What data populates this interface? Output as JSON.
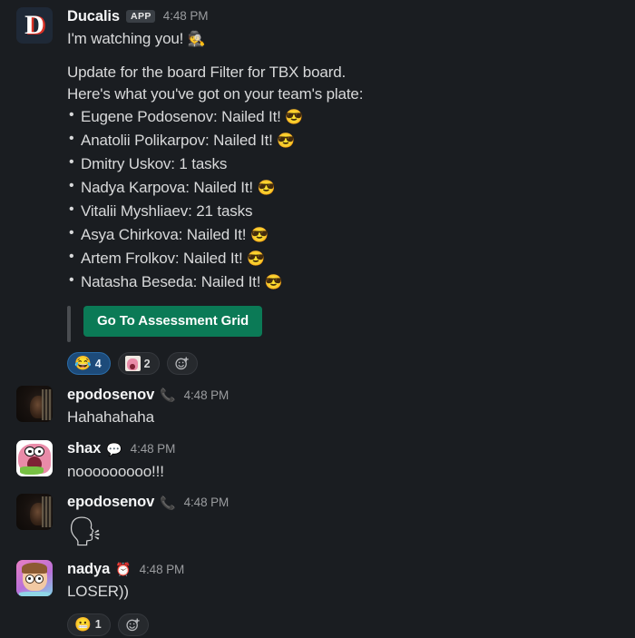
{
  "app": {
    "theme_background": "#1a1d21",
    "accent_green": "#0b7a56",
    "reaction_selected_blue": "#1d4b7a"
  },
  "messages": [
    {
      "id": "ducalis-bot-message",
      "author": "Ducalis",
      "badge": "APP",
      "timestamp": "4:48 PM",
      "avatar_name": "ducalis-app-avatar",
      "avatar_letter": "D",
      "greeting": "I'm watching you!",
      "greeting_emoji": "🕵️",
      "paragraphs": [
        "Update for the board Filter for TBX board.",
        "Here's what you've got on your team's plate:"
      ],
      "bullets": [
        {
          "text": "Eugene Podosenov: Nailed It!",
          "emoji": "😎"
        },
        {
          "text": "Anatolii Polikarpov: Nailed It!",
          "emoji": "😎"
        },
        {
          "text": "Dmitry Uskov: 1 tasks",
          "emoji": ""
        },
        {
          "text": "Nadya Karpova: Nailed It!",
          "emoji": "😎"
        },
        {
          "text": "Vitalii Myshliaev: 21 tasks",
          "emoji": ""
        },
        {
          "text": "Asya Chirkova: Nailed It!",
          "emoji": "😎"
        },
        {
          "text": "Artem Frolkov: Nailed It!",
          "emoji": "😎"
        },
        {
          "text": "Natasha Beseda: Nailed It!",
          "emoji": "😎"
        }
      ],
      "cta_label": "Go To Assessment Grid",
      "reactions": [
        {
          "emoji": "😂",
          "count": "4",
          "selected": true,
          "name": "reaction-joy"
        },
        {
          "emoji": "",
          "count": "2",
          "selected": false,
          "name": "reaction-custom-patrick"
        }
      ],
      "add_reaction_label": "add-reaction"
    },
    {
      "id": "message-epodosenov-1",
      "author": "epodosenov",
      "status_emoji": "📞",
      "timestamp": "4:48 PM",
      "avatar_name": "epodosenov-avatar",
      "text": "Hahahahaha"
    },
    {
      "id": "message-shax",
      "author": "shax",
      "status_emoji": "💬",
      "timestamp": "4:48 PM",
      "avatar_name": "shax-avatar",
      "text": "nooooooooo!!!"
    },
    {
      "id": "message-epodosenov-2",
      "author": "epodosenov",
      "status_emoji": "📞",
      "timestamp": "4:48 PM",
      "avatar_name": "epodosenov-avatar",
      "text": "",
      "emoji_only": "🗣"
    },
    {
      "id": "message-nadya",
      "author": "nadya",
      "status_emoji": "⏰",
      "timestamp": "4:48 PM",
      "avatar_name": "nadya-avatar",
      "text": "LOSER))",
      "reactions": [
        {
          "emoji": "😬",
          "count": "1",
          "selected": false,
          "name": "reaction-grimace"
        }
      ],
      "add_reaction_label": "add-reaction"
    }
  ]
}
